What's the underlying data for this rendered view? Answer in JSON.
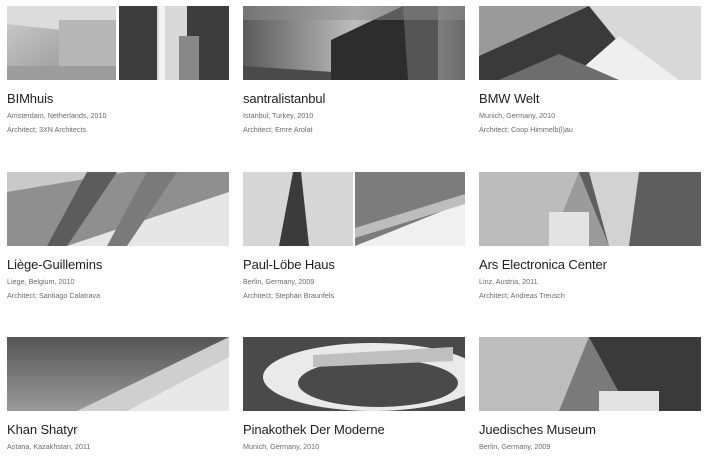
{
  "projects": [
    {
      "title": "BIMhuis",
      "location": "Amsterdam, Netherlands, 2010",
      "architect": "Architect; 3XN Architects"
    },
    {
      "title": "santralistanbul",
      "location": "Istanbul; Turkey, 2010",
      "architect": "Architect; Emre Arolat"
    },
    {
      "title": "BMW Welt",
      "location": "Munich, Germany, 2010",
      "architect": "Architect; Coop Himmelb(l)au"
    },
    {
      "title": "Liège-Guillemins",
      "location": "Liege, Belgium, 2010",
      "architect": "Architect; Santiago Calatrava"
    },
    {
      "title": "Paul-Löbe Haus",
      "location": "Berlin, Germany, 2009",
      "architect": "Architect; Stephan Braunfels"
    },
    {
      "title": "Ars Electronica Center",
      "location": "Linz, Austria, 2011",
      "architect": "Architect; Andreas Treusch"
    },
    {
      "title": "Khan Shatyr",
      "location": "Astana, Kazakhstan, 2011",
      "architect": ""
    },
    {
      "title": "Pinakothek Der Moderne",
      "location": "Munich, Germany, 2010",
      "architect": ""
    },
    {
      "title": "Juedisches Museum",
      "location": "Berlin, Germany, 2009",
      "architect": ""
    }
  ]
}
